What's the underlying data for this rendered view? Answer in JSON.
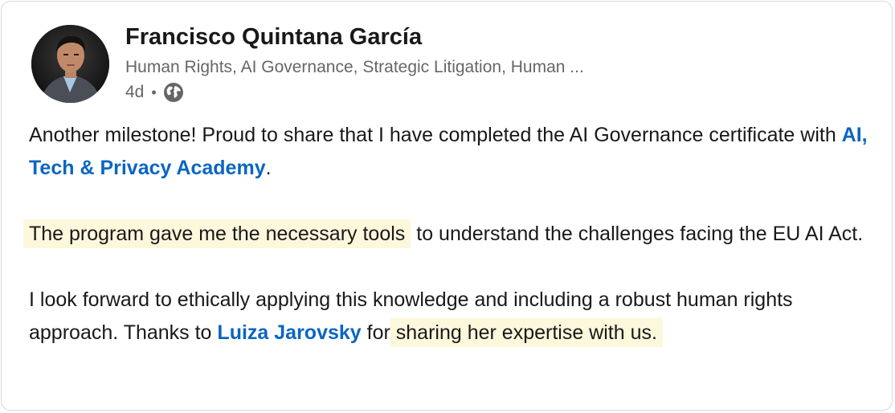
{
  "post": {
    "author": {
      "name": "Francisco Quintana García",
      "headline": "Human Rights, AI Governance, Strategic Litigation, Human ...",
      "timestamp": "4d",
      "separator": "•",
      "visibility_icon": "globe-icon"
    },
    "paragraphs": {
      "p1": {
        "text_a": "Another milestone! Proud to share that I have completed the AI Governance certificate with ",
        "mention": "AI, Tech & Privacy Academy",
        "text_b": "."
      },
      "p2": {
        "highlight": "The program gave me the necessary tools",
        "text": " to understand the challenges facing the EU AI Act."
      },
      "p3": {
        "text_a": "I look forward to ethically applying this knowledge and including a robust human rights approach. Thanks to ",
        "mention": "Luiza Jarovsky",
        "text_b": " for ",
        "highlight": "sharing her expertise with us."
      }
    },
    "colors": {
      "mention": "#0a66c2",
      "highlight": "#fdf7dc",
      "text": "#191919",
      "secondary_text": "#666666"
    }
  }
}
